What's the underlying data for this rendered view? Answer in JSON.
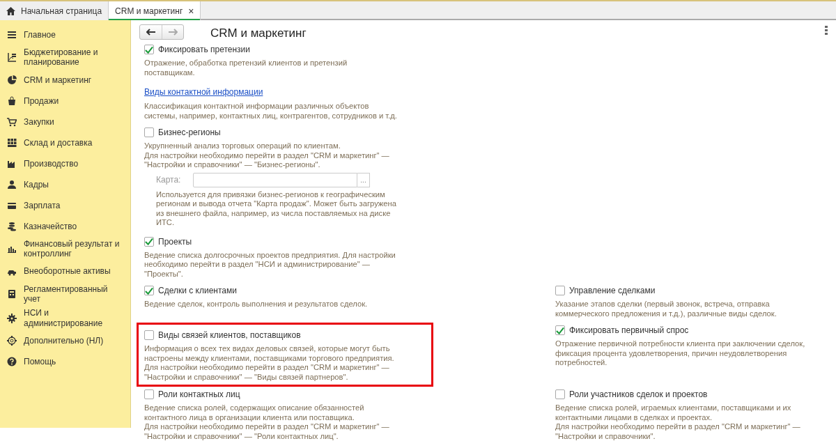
{
  "tabs": [
    {
      "label": "Начальная страница",
      "kind": "home",
      "selected": false
    },
    {
      "label": "CRM и маркетинг",
      "kind": "closable",
      "selected": true,
      "close": "×"
    }
  ],
  "sidebar": {
    "items": [
      {
        "label": "Главное"
      },
      {
        "label": "Бюджетирование и планирование"
      },
      {
        "label": "CRM и маркетинг"
      },
      {
        "label": "Продажи"
      },
      {
        "label": "Закупки"
      },
      {
        "label": "Склад и доставка"
      },
      {
        "label": "Производство"
      },
      {
        "label": "Кадры"
      },
      {
        "label": "Зарплата"
      },
      {
        "label": "Казначейство"
      },
      {
        "label": "Финансовый результат и контроллинг"
      },
      {
        "label": "Внеоборотные активы"
      },
      {
        "label": "Регламентированный учет"
      },
      {
        "label": "НСИ и администрирование"
      },
      {
        "label": "Дополнительно (НЛ)"
      },
      {
        "label": "Помощь"
      }
    ]
  },
  "page": {
    "title": "CRM и маркетинг"
  },
  "rows": [
    {
      "left": {
        "kind": "checkbox",
        "label": "Фиксировать претензии",
        "checked": true,
        "description": "Отражение, обработка претензий клиентов и претензий поставщикам."
      }
    },
    {
      "left": {
        "kind": "link",
        "label": "Виды контактной информации",
        "description": "Классификация контактной информации различных объектов системы, например, контактных лиц, контрагентов, сотрудников и т.д."
      }
    },
    {
      "left": {
        "kind": "checkbox",
        "label": "Бизнес-регионы",
        "checked": false,
        "description": "Укрупненный анализ торговых операций по клиентам.\nДля настройки необходимо перейти в раздел \"CRM и маркетинг\" — \"Настройки и справочники\" — \"Бизнес-регионы\".",
        "field": {
          "label": "Карта:",
          "button": "...",
          "disabled": true,
          "note": "Используется для привязки бизнес-регионов к географическим регионам и вывода отчета \"Карта продаж\". Может быть загружена из внешнего файла, например, из числа поставляемых на диске ИТС."
        }
      }
    },
    {
      "left": {
        "kind": "checkbox",
        "label": "Проекты",
        "checked": true,
        "description": "Ведение списка долгосрочных проектов предприятия. Для настройки необходимо перейти в раздел \"НСИ и администрирование\" — \"Проекты\"."
      }
    },
    {
      "left": {
        "kind": "checkbox",
        "label": "Сделки с клиентами",
        "checked": true,
        "description": "Ведение сделок, контроль выполнения и результатов сделок."
      },
      "right": {
        "kind": "checkbox",
        "label": "Управление сделками",
        "checked": false,
        "description": "Указание этапов сделки (первый звонок, встреча, отправка коммерческого предложения и т.д.), различные виды сделок."
      }
    },
    {
      "left": {
        "kind": "checkbox",
        "label": "Виды связей клиентов, поставщиков",
        "checked": false,
        "highlighted": true,
        "description": "Информация о всех тех видах деловых связей, которые могут быть настроены между клиентами, поставщиками торгового предприятия.\nДля настройки необходимо перейти в раздел \"CRM и маркетинг\" — \"Настройки и справочники\" — \"Виды связей партнеров\"."
      },
      "right": {
        "kind": "checkbox",
        "label": "Фиксировать первичный спрос",
        "checked": true,
        "description": "Отражение первичной потребности клиента при заключении сделок, фиксация процента удовлетворения, причин неудовлетворения потребностей."
      }
    },
    {
      "left": {
        "kind": "checkbox",
        "label": "Роли контактных лиц",
        "checked": false,
        "description": "Ведение списка ролей, содержащих описание обязанностей контактного лица в организации клиента или поставщика.\nДля настройки необходимо перейти в раздел \"CRM и маркетинг\" — \"Настройки и справочники\" — \"Роли контактных лиц\"."
      },
      "right": {
        "kind": "checkbox",
        "label": "Роли участников сделок и проектов",
        "checked": false,
        "description": "Ведение списка ролей, играемых клиентами, поставщиками и их контактными лицами в сделках и проектах.\nДля настройки необходимо перейти в раздел \"CRM и маркетинг\" — \"Настройки и справочники\"."
      }
    }
  ]
}
